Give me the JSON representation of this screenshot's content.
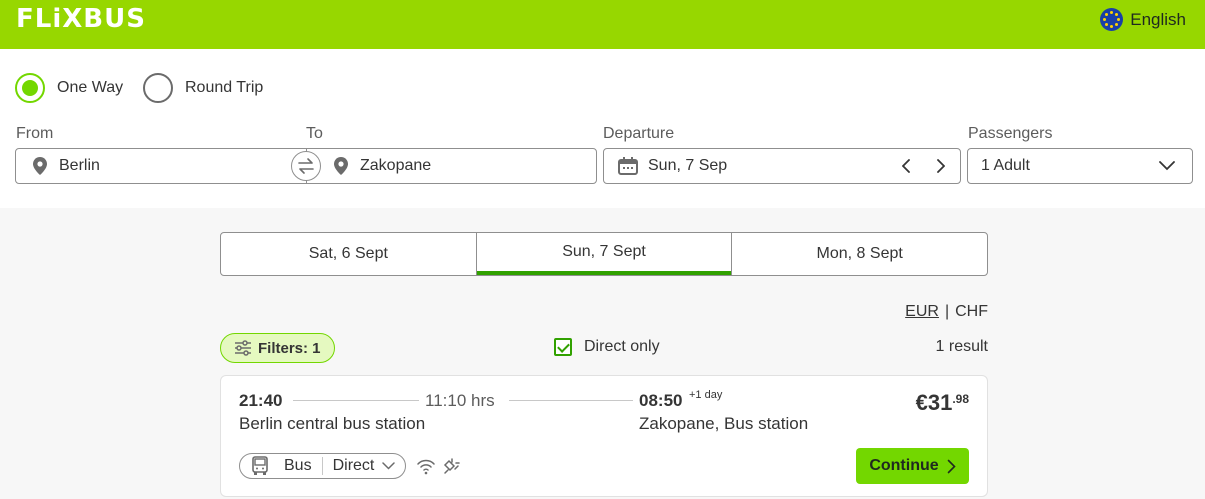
{
  "header": {
    "logo": "FLiXBUS",
    "language": "English"
  },
  "search": {
    "trip_type": {
      "one_way": "One Way",
      "round_trip": "Round Trip",
      "selected": "one_way"
    },
    "from": {
      "label": "From",
      "value": "Berlin"
    },
    "to": {
      "label": "To",
      "value": "Zakopane"
    },
    "departure": {
      "label": "Departure",
      "value": "Sun, 7 Sep"
    },
    "passengers": {
      "label": "Passengers",
      "value": "1 Adult"
    }
  },
  "date_tabs": [
    {
      "label": "Sat, 6 Sept"
    },
    {
      "label": "Sun, 7 Sept",
      "active": true
    },
    {
      "label": "Mon, 8 Sept"
    }
  ],
  "currency": {
    "eur": "EUR",
    "separator": "|",
    "chf": "CHF",
    "selected": "EUR"
  },
  "filters": {
    "label": "Filters: 1"
  },
  "direct_only": {
    "label": "Direct only",
    "checked": true
  },
  "results_count": "1 result",
  "results": [
    {
      "departure_time": "21:40",
      "duration": "11:10 hrs",
      "arrival_time": "08:50",
      "arrival_offset": "+1 day",
      "from_station": "Berlin central bus station",
      "to_station": "Zakopane, Bus station",
      "price_main": "€31",
      "price_cents": ".98",
      "transport": "Bus",
      "connection": "Direct",
      "amenities": [
        "wifi-icon",
        "power-socket-icon"
      ],
      "continue_label": "Continue"
    }
  ],
  "colors": {
    "brand_green": "#97d700",
    "accent_green": "#73d700",
    "active_tab_underline": "#31a100"
  }
}
